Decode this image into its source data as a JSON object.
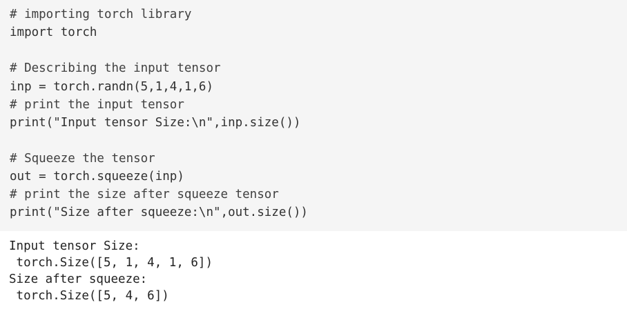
{
  "code": {
    "lines": [
      "# importing torch library",
      "import torch",
      "",
      "# Describing the input tensor",
      "inp = torch.randn(5,1,4,1,6)",
      "# print the input tensor",
      "print(\"Input tensor Size:\\n\",inp.size())",
      "",
      "# Squeeze the tensor",
      "out = torch.squeeze(inp)",
      "# print the size after squeeze tensor",
      "print(\"Size after squeeze:\\n\",out.size())"
    ]
  },
  "output": {
    "lines": [
      "Input tensor Size:",
      " torch.Size([5, 1, 4, 1, 6])",
      "Size after squeeze:",
      " torch.Size([5, 4, 6])"
    ]
  }
}
